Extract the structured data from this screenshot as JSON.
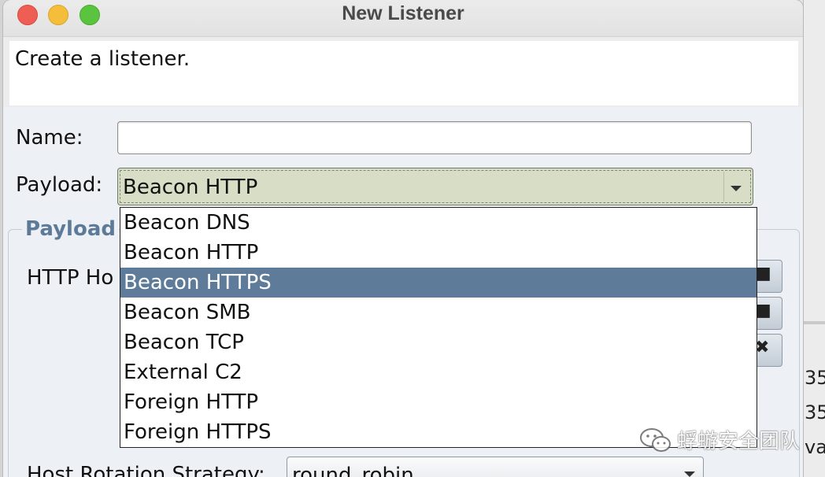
{
  "window": {
    "title": "New Listener"
  },
  "description": "Create a listener.",
  "form": {
    "name_label": "Name:",
    "name_value": "",
    "payload_label": "Payload:",
    "payload_selected": "Beacon HTTP"
  },
  "payload_group": {
    "title": "Payload",
    "http_hosts_label": "HTTP Ho",
    "host_rotation_label": "Host Rotation Strategy:",
    "host_rotation_value": "round_robin"
  },
  "dropdown": {
    "items": [
      "Beacon DNS",
      "Beacon HTTP",
      "Beacon HTTPS",
      "Beacon SMB",
      "Beacon TCP",
      "External C2",
      "Foreign HTTP",
      "Foreign HTTPS"
    ],
    "highlighted": "Beacon HTTPS"
  },
  "background": {
    "right_fragments": [
      "35",
      "35",
      "va"
    ]
  },
  "watermark": {
    "text": "蜉蝣安全团队"
  },
  "colors": {
    "selection": "#5e7b99",
    "group_title": "#5d7b98",
    "combo_bg": "#d8ddc6",
    "close": "#ee5e55",
    "minimize": "#f4bd3a",
    "maximize": "#5ac43f"
  }
}
